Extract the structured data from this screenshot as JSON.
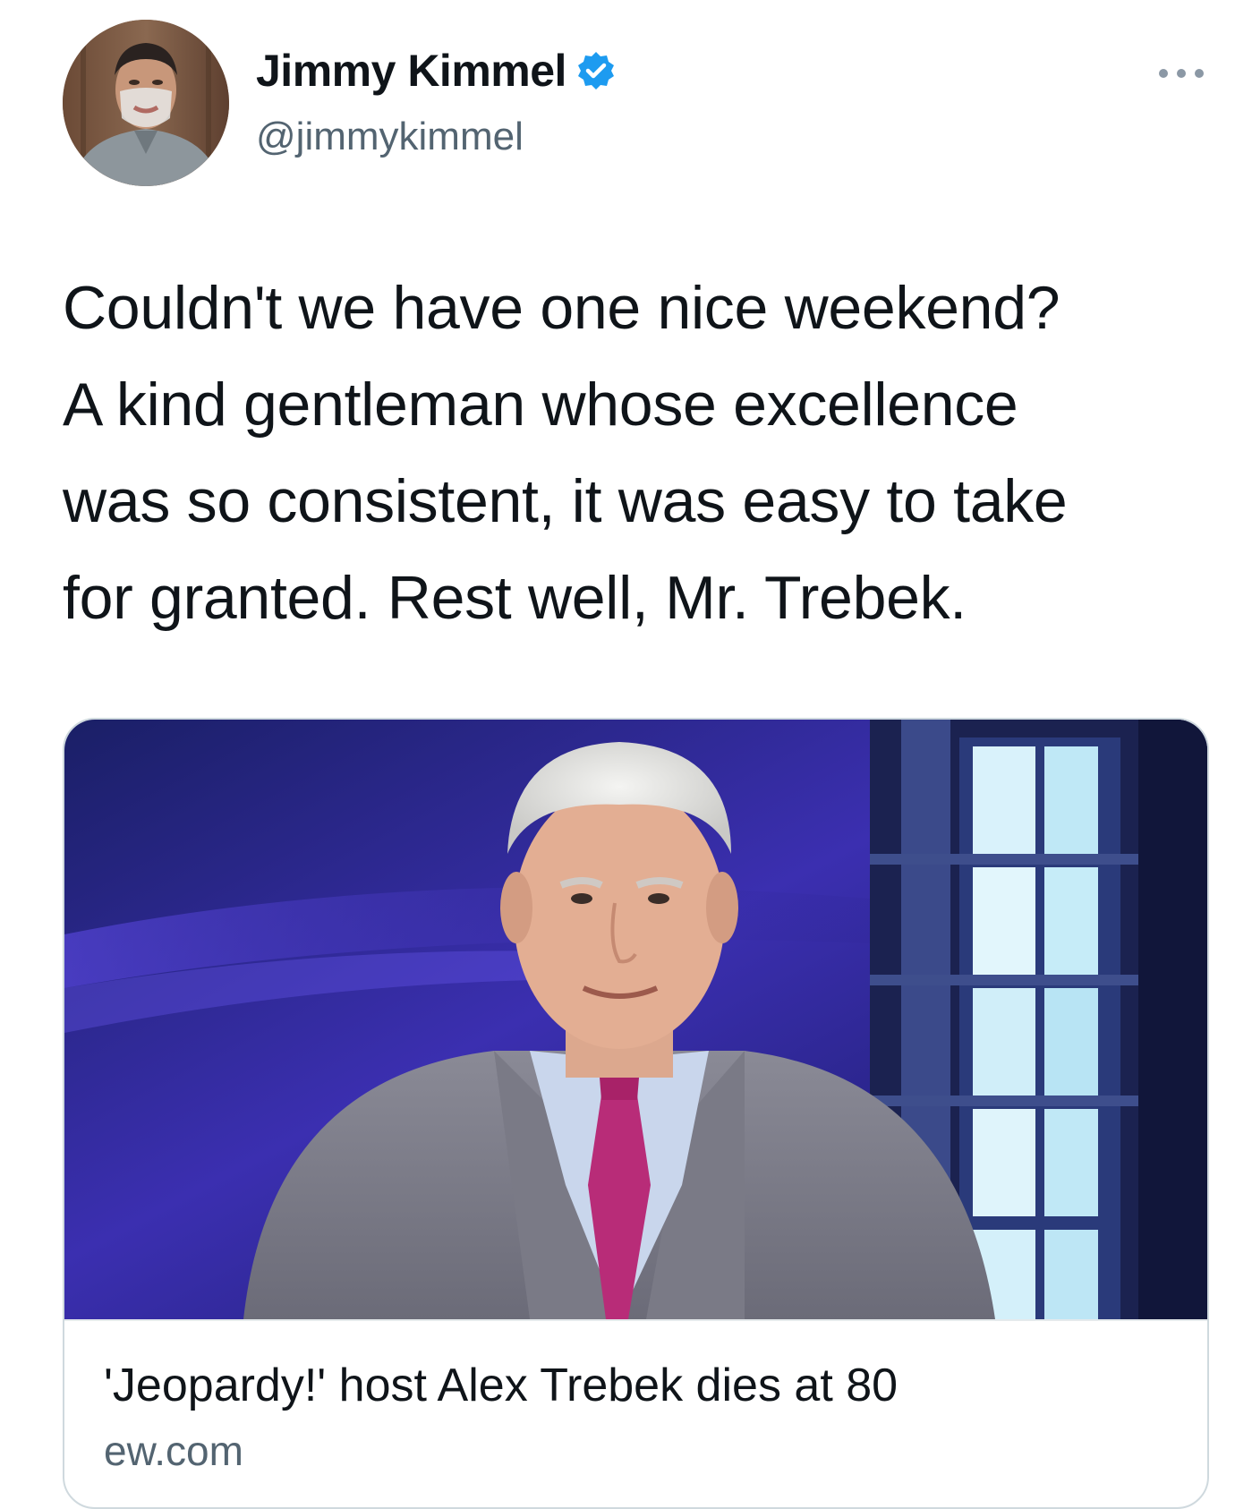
{
  "author": {
    "display_name": "Jimmy Kimmel",
    "handle": "@jimmykimmel",
    "verified": true,
    "avatar_icon": "profile-photo",
    "verified_icon": "verified-badge-icon",
    "verified_color": "#1d9bf0"
  },
  "actions": {
    "more_icon": "more-horizontal-icon"
  },
  "tweet": {
    "lines": [
      "Couldn't we have one nice weekend?",
      "A kind gentleman whose excellence",
      "was so consistent, it was easy to take",
      "for granted. Rest well, Mr. Trebek."
    ]
  },
  "link_card": {
    "image_icon": "article-photo",
    "title": "'Jeopardy!' host Alex Trebek dies at 80",
    "domain": "ew.com"
  }
}
